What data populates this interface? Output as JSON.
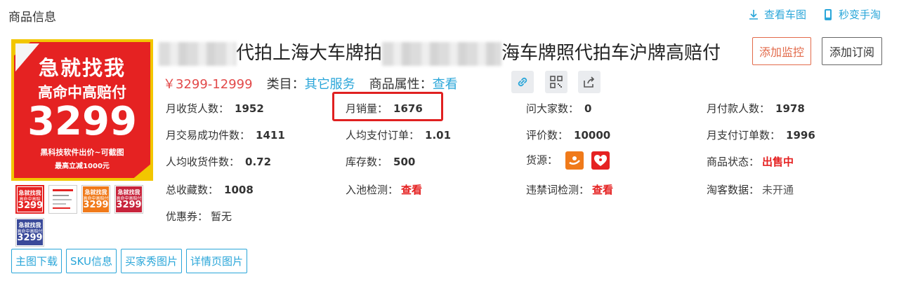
{
  "header": {
    "title": "商品信息"
  },
  "top_links": [
    {
      "label": "查看车图",
      "icon": "download-icon"
    },
    {
      "label": "秒变手淘",
      "icon": "phone-icon"
    }
  ],
  "main_image": {
    "line1": "急就找我",
    "line2": "高命中高赔付",
    "line3": "3299",
    "line4": "黑科技软件出价~可截图",
    "line5": "最高立减1000元"
  },
  "thumbnails": [
    {
      "line1": "急就找我",
      "line2": "高命中高赔付",
      "line3": "3299",
      "color": "#e52222"
    },
    {
      "line1": "",
      "line2": "",
      "line3": "",
      "color": "#ffffff"
    },
    {
      "line1": "急就找我",
      "line2": "高命中高赔付",
      "line3": "3299",
      "color": "#f07a1a"
    },
    {
      "line1": "急就找我",
      "line2": "高命中高赔付",
      "line3": "3299",
      "color": "#c8243c"
    },
    {
      "line1": "急就找我",
      "line2": "高命中高赔付",
      "line3": "3299",
      "color": "#3a4a9a"
    }
  ],
  "bottom_buttons": [
    "主图下载",
    "SKU信息",
    "买家秀图片",
    "详情页图片"
  ],
  "product": {
    "title_part1": "代拍上海大车牌拍",
    "title_part2": "海车牌照代拍车沪牌高赔付",
    "price": "￥3299-12999",
    "category_label": "类目：",
    "category_value": "其它服务",
    "attr_label": "商品属性：",
    "attr_value": "查看"
  },
  "actions": {
    "monitor": "添加监控",
    "subscribe": "添加订阅"
  },
  "stats": {
    "monthly_buyers_label": "月收货人数：",
    "monthly_buyers": "1952",
    "monthly_sales_label": "月销量：",
    "monthly_sales": "1676",
    "ask_label": "问大家数：",
    "ask": "0",
    "paid_label": "月付款人数：",
    "paid": "1978",
    "deal_items_label": "月交易成功件数：",
    "deal_items": "1411",
    "avg_orders_label": "人均支付订单：",
    "avg_orders": "1.01",
    "reviews_label": "评价数：",
    "reviews": "10000",
    "pay_orders_label": "月支付订单数：",
    "pay_orders": "1996",
    "avg_items_label": "人均收货件数：",
    "avg_items": "0.72",
    "stock_label": "库存数：",
    "stock": "500",
    "source_label": "货源：",
    "status_label": "商品状态：",
    "status": "出售中",
    "favorites_label": "总收藏数：",
    "favorites": "1008",
    "pool_label": "入池检测：",
    "pool": "查看",
    "banned_label": "违禁词检测：",
    "banned": "查看",
    "taoke_label": "淘客数据：",
    "taoke": "未开通",
    "coupon_label": "优惠券：",
    "coupon": "暂无"
  },
  "colors": {
    "accent": "#2aa6d9",
    "red": "#e52222",
    "monitor": "#e26a4a"
  }
}
